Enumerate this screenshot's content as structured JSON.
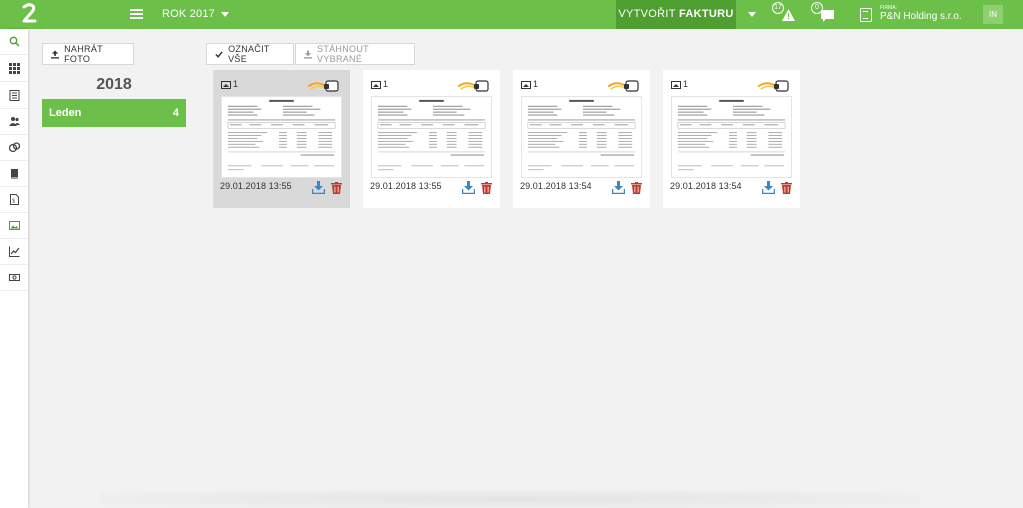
{
  "header": {
    "year_label": "ROK 2017",
    "create_prefix": "VYTVOŘIT",
    "create_bold": "FAKTURU",
    "alerts_count": "17",
    "messages_count": "0",
    "company_caption": "FIRMA:",
    "company_name": "P&N Holding s.r.o.",
    "avatar_initials": "IN"
  },
  "sidebar": {
    "icons": [
      "search-icon",
      "apps-grid-icon",
      "document-list-icon",
      "users-icon",
      "coins-icon",
      "books-icon",
      "invoice-icon",
      "photo-icon",
      "chart-line-icon",
      "cash-icon"
    ]
  },
  "toolbar": {
    "upload_label": "NAHRÁT FOTO",
    "select_all_label": "OZNAČIT VŠE",
    "download_selected_label": "STÁHNOUT VYBRANÉ"
  },
  "archive": {
    "year": "2018",
    "months": [
      {
        "label": "Leden",
        "count": "4"
      }
    ]
  },
  "photos": [
    {
      "pages": "1",
      "date": "29.01.2018 13:55",
      "selected": true
    },
    {
      "pages": "1",
      "date": "29.01.2018 13:55",
      "selected": false
    },
    {
      "pages": "1",
      "date": "29.01.2018 13:54",
      "selected": false
    },
    {
      "pages": "1",
      "date": "29.01.2018 13:54",
      "selected": false
    }
  ],
  "colors": {
    "brand_green": "#6cc04a",
    "brand_green_dark": "#4e9e30",
    "download_blue": "#3a86c8",
    "delete_red": "#c0392b"
  }
}
